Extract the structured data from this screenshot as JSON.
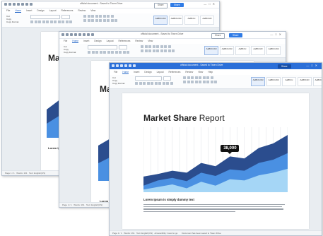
{
  "app": {
    "document_title": "official document - Saved to Tiwen Drive",
    "share_label": "Share",
    "tabs": [
      "File",
      "Home",
      "Insert",
      "Design",
      "Layout",
      "References",
      "Review",
      "View",
      "Help"
    ],
    "active_tab": "Home",
    "ribbon": {
      "cut": "Cut",
      "copy": "Copy",
      "format_painter": "Copy Format",
      "paste": "Paste",
      "styles": [
        "AaBbCcDd",
        "AaBbCcDd",
        "AaBbCc",
        "AaBbCcD",
        "AaBbCcDd",
        "AaBbCcDd"
      ],
      "style_names": [
        "Normal",
        "No Spacing",
        "Title",
        "Subtitle",
        "Heading 1",
        "Heading 2"
      ]
    }
  },
  "document": {
    "title_bold": "Market Share",
    "title_light": "Report",
    "callout_value": "38,000",
    "subheading": "Lorem Ipsum is simply dummy text",
    "body_lines": 4
  },
  "status": {
    "page": "Page 1 / 1",
    "words": "Words: 161",
    "language": "Text: English(US)",
    "accessibility": "Accessibility: Good to go",
    "autosave": "Document has been saved to Tiwen Drive",
    "zoom": "100%"
  },
  "chart_data": {
    "type": "area",
    "series": [
      {
        "color": "#2b4d8e",
        "values": [
          24,
          28,
          33,
          30,
          45,
          40,
          55,
          52,
          68,
          75,
          88
        ]
      },
      {
        "color": "#4a90e2",
        "values": [
          10,
          18,
          22,
          17,
          30,
          25,
          35,
          33,
          45,
          50,
          60
        ]
      },
      {
        "color": "#a5d6f6",
        "values": [
          4,
          8,
          12,
          6,
          16,
          10,
          20,
          18,
          26,
          30,
          36
        ]
      }
    ],
    "callout_value": "38,000",
    "grid": true
  },
  "colors": {
    "accent": "#2f7be6",
    "dark_blue": "#2b4d8e",
    "mid_blue": "#4a90e2",
    "light_blue": "#a5d6f6"
  }
}
